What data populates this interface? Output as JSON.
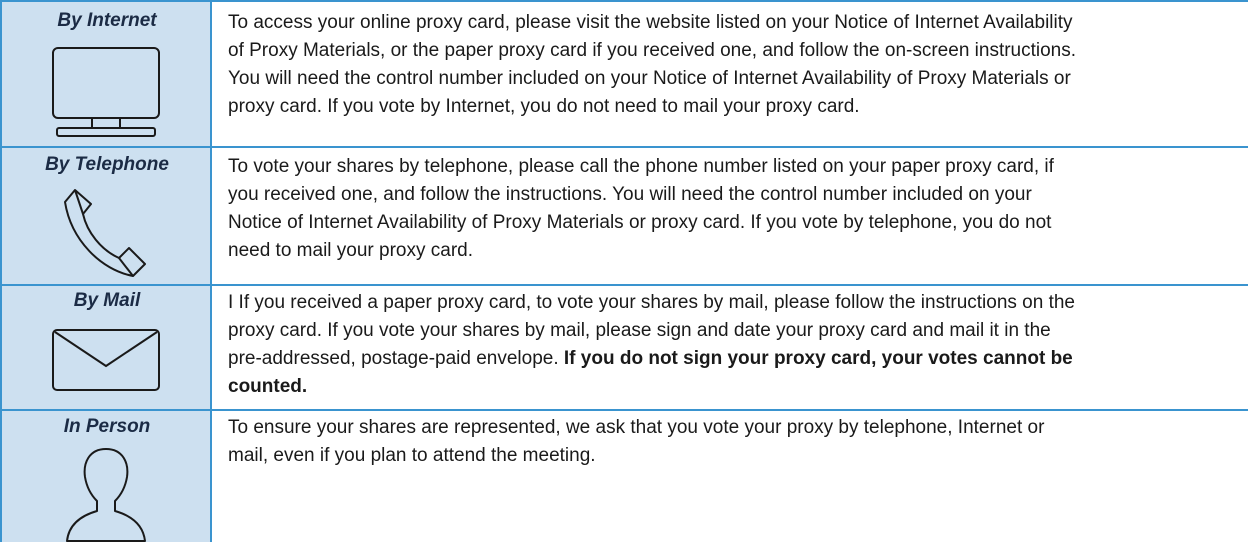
{
  "rows": [
    {
      "method": "By Internet",
      "icon": "monitor-icon",
      "lines": [
        "To access your online proxy card, please visit the website listed on your Notice of Internet Availability",
        "of Proxy Materials, or the paper proxy card if you received one, and follow the on-screen instructions.",
        "You will need the control number included on your Notice of Internet Availability of Proxy Materials or",
        "proxy card. If you vote by Internet, you do not need to mail your proxy card."
      ]
    },
    {
      "method": "By Telephone",
      "icon": "telephone-icon",
      "lines": [
        "To vote your shares by telephone, please call the phone number listed on your paper proxy card, if",
        "you received one, and follow the instructions. You will need the control number included on your",
        "Notice of Internet Availability of Proxy Materials or proxy card. If you vote by telephone, you do not",
        "need to mail your proxy card."
      ]
    },
    {
      "method": "By Mail",
      "icon": "envelope-icon",
      "lines": [
        "I If you received a paper proxy card, to vote your shares by mail, please follow the instructions on the",
        "proxy card. If you vote your shares by mail, please sign and date your proxy card and mail it in the"
      ],
      "line3_normal": "pre-addressed, postage-paid envelope. ",
      "line3_bold": "If you do not sign your proxy card, your votes cannot be",
      "line4_bold": "counted."
    },
    {
      "method": "In Person",
      "icon": "person-icon",
      "lines": [
        "To ensure your shares are represented, we ask that you vote your proxy by telephone, Internet or",
        "mail, even if you plan to attend the meeting."
      ]
    }
  ],
  "colors": {
    "border": "#3a94cf",
    "method_background": "#cde0f0",
    "label_text": "#1b2b45"
  }
}
